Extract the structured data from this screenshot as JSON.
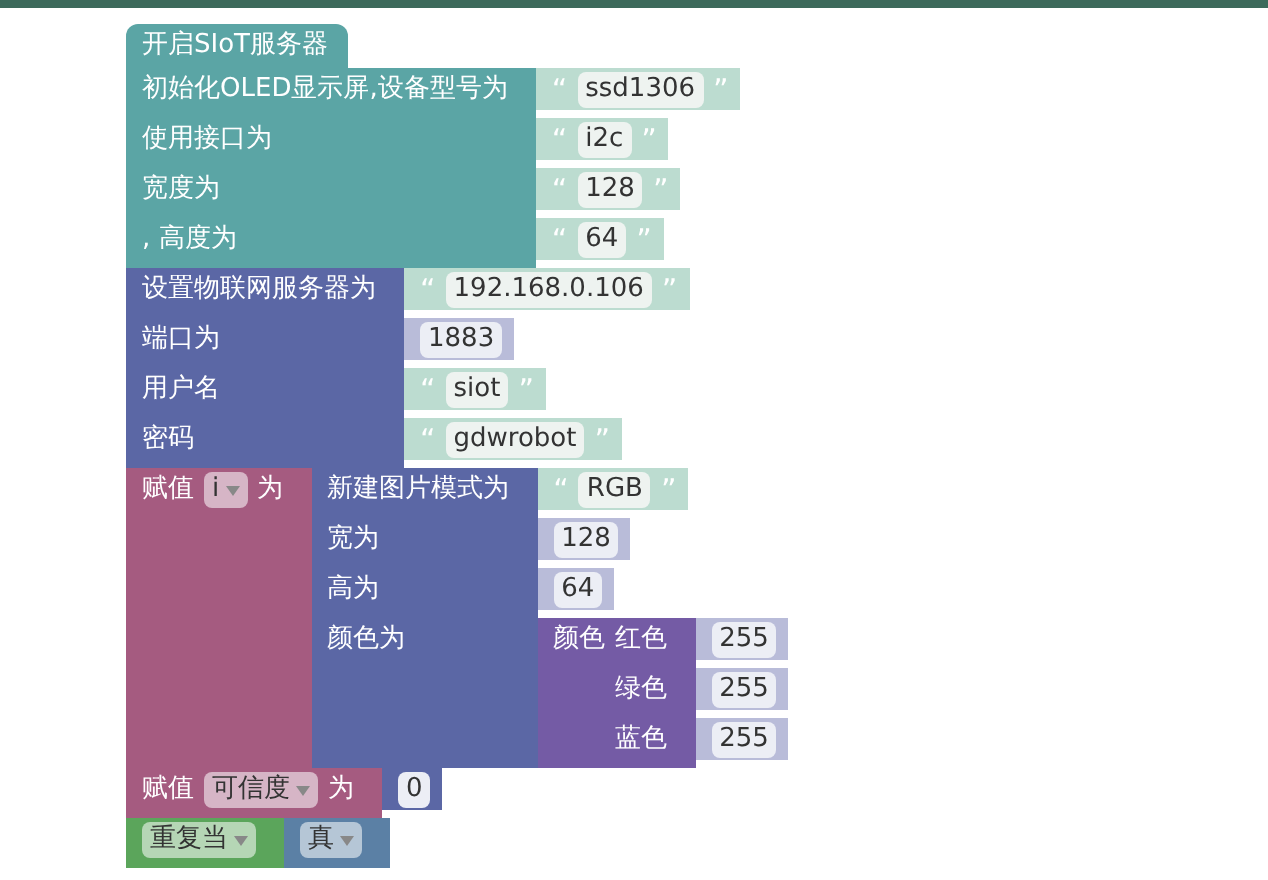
{
  "hat": {
    "label": "开启SIoT服务器",
    "color": "#5ba5a5"
  },
  "blocks": [
    {
      "kind": "statement",
      "color": "#5ba5a5",
      "rows": [
        {
          "label": [
            {
              "kind": "text",
              "text": "初始化OLED显示屏,设备型号为"
            }
          ],
          "input": {
            "kind": "string",
            "open": "“",
            "text": "ssd1306",
            "close": "”"
          }
        },
        {
          "label": [
            {
              "kind": "text",
              "text": "使用接口为"
            }
          ],
          "input": {
            "kind": "string",
            "open": "“",
            "text": "i2c",
            "close": "”"
          }
        },
        {
          "label": [
            {
              "kind": "text",
              "text": "宽度为"
            }
          ],
          "input": {
            "kind": "string",
            "open": "“",
            "text": "128",
            "close": "”"
          }
        },
        {
          "label": [
            {
              "kind": "text",
              "text": ", 高度为"
            }
          ],
          "input": {
            "kind": "string",
            "open": "“",
            "text": "64",
            "close": "”"
          }
        }
      ]
    },
    {
      "kind": "statement",
      "color": "#5b67a5",
      "rows": [
        {
          "label": [
            {
              "kind": "text",
              "text": "设置物联网服务器为"
            }
          ],
          "input": {
            "kind": "string",
            "open": "“",
            "text": "192.168.0.106",
            "close": "”"
          }
        },
        {
          "label": [
            {
              "kind": "text",
              "text": "端口为"
            }
          ],
          "input": {
            "kind": "number",
            "color": "#b9bcd9",
            "text": "1883"
          }
        },
        {
          "label": [
            {
              "kind": "text",
              "text": "用户名"
            }
          ],
          "input": {
            "kind": "string",
            "open": "“",
            "text": "siot",
            "close": "”"
          }
        },
        {
          "label": [
            {
              "kind": "text",
              "text": "密码"
            }
          ],
          "input": {
            "kind": "string",
            "open": "“",
            "text": "gdwrobot",
            "close": "”"
          }
        }
      ]
    },
    {
      "kind": "statement",
      "color": "#a55b80",
      "rows": [
        {
          "label": [
            {
              "kind": "text",
              "text": "赋值"
            },
            {
              "kind": "dropdown",
              "text": "i"
            },
            {
              "kind": "text",
              "text": "为"
            }
          ],
          "input": {
            "kind": "block",
            "color": "#5b67a5",
            "rows": [
              {
                "label": [
                  {
                    "kind": "text",
                    "text": "新建图片模式为"
                  }
                ],
                "input": {
                  "kind": "string",
                  "open": "“",
                  "text": "RGB",
                  "close": "”"
                }
              },
              {
                "label": [
                  {
                    "kind": "text",
                    "text": "宽为"
                  }
                ],
                "input": {
                  "kind": "number",
                  "color": "#b9bcd9",
                  "text": "128"
                }
              },
              {
                "label": [
                  {
                    "kind": "text",
                    "text": "高为"
                  }
                ],
                "input": {
                  "kind": "number",
                  "color": "#b9bcd9",
                  "text": "64"
                }
              },
              {
                "label": [
                  {
                    "kind": "text",
                    "text": "颜色为"
                  }
                ],
                "input": {
                  "kind": "color_block",
                  "color": "#745ba5",
                  "rows": [
                    {
                      "label": [
                        {
                          "kind": "text",
                          "text": "颜色"
                        },
                        {
                          "kind": "text",
                          "text": "红色"
                        }
                      ],
                      "input": {
                        "kind": "number",
                        "color": "#b9bcd9",
                        "text": "255"
                      }
                    },
                    {
                      "label": [
                        {
                          "kind": "text",
                          "text": "绿色"
                        }
                      ],
                      "input": {
                        "kind": "number",
                        "color": "#b9bcd9",
                        "text": "255"
                      }
                    },
                    {
                      "label": [
                        {
                          "kind": "text",
                          "text": "蓝色"
                        }
                      ],
                      "input": {
                        "kind": "number",
                        "color": "#b9bcd9",
                        "text": "255"
                      }
                    }
                  ]
                }
              }
            ]
          }
        }
      ]
    },
    {
      "kind": "statement",
      "color": "#a55b80",
      "rows": [
        {
          "label": [
            {
              "kind": "text",
              "text": "赋值"
            },
            {
              "kind": "dropdown",
              "text": "可信度"
            },
            {
              "kind": "text",
              "text": "为"
            }
          ],
          "input": {
            "kind": "number",
            "color": "#5b67a5",
            "text": "0"
          }
        }
      ]
    },
    {
      "kind": "statement",
      "color": "#5ba55b",
      "rows": [
        {
          "label": [
            {
              "kind": "dropdown",
              "text": "重复当"
            }
          ],
          "input": {
            "kind": "block",
            "color": "#5b80a5",
            "rows": [
              {
                "label": [
                  {
                    "kind": "dropdown",
                    "text": "真"
                  }
                ]
              }
            ]
          }
        }
      ]
    }
  ]
}
